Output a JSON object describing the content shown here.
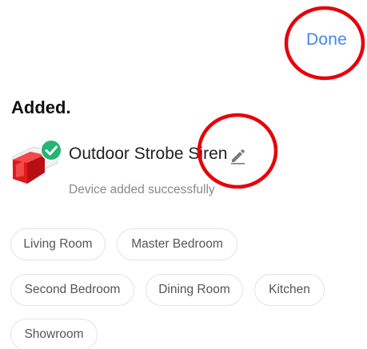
{
  "header": {
    "done_label": "Done"
  },
  "title": "Added.",
  "device": {
    "name": "Outdoor Strobe Siren",
    "status": "Device added successfully"
  },
  "rooms": [
    "Living Room",
    "Master Bedroom",
    "Second Bedroom",
    "Dining Room",
    "Kitchen",
    "Showroom"
  ],
  "colors": {
    "accent": "#4a86e8",
    "success": "#22b573",
    "siren_red": "#e0191e",
    "annotation": "#e8000a"
  },
  "icons": {
    "device": "strobe-siren-icon",
    "status": "check-icon",
    "edit": "pencil-icon"
  }
}
